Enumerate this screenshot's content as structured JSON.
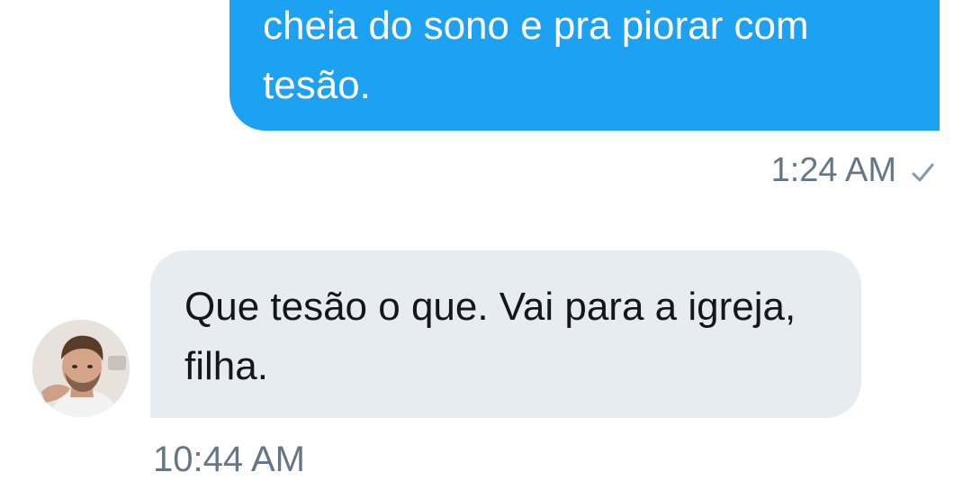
{
  "conversation": {
    "outgoing_message": {
      "text": "cheia do sono e pra piorar com tesão.",
      "timestamp": "1:24 AM",
      "status_icon": "check-icon",
      "bubble_color": "#1da1f2"
    },
    "incoming_message": {
      "text": "Que tesão o que. Vai para a igreja, filha.",
      "timestamp": "10:44 AM",
      "avatar_icon": "avatar",
      "bubble_color": "#e6ecf0"
    }
  },
  "colors": {
    "meta_text": "#657786",
    "incoming_text": "#14171a",
    "outgoing_text": "#ffffff"
  }
}
